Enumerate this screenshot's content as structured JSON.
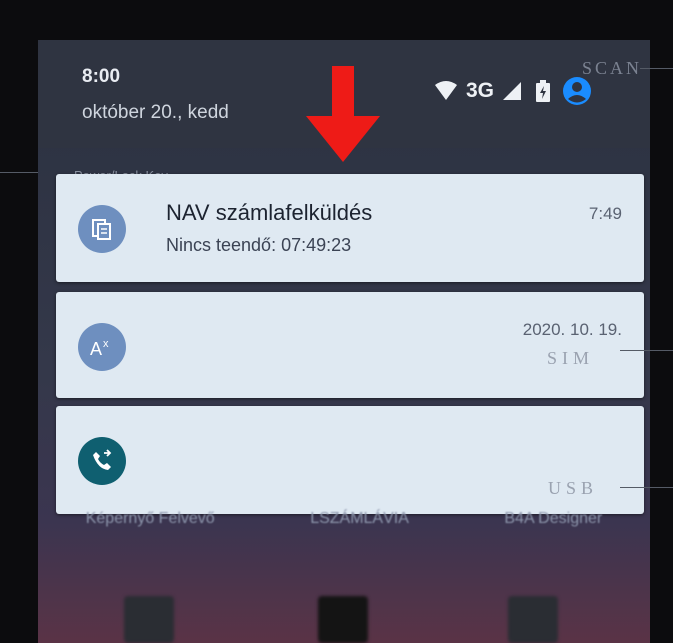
{
  "status_bar": {
    "time": "8:00",
    "date": "október 20., kedd",
    "network_label": "3G",
    "icons": [
      "wifi-icon",
      "signal-icon",
      "battery-icon",
      "account-icon"
    ],
    "account_color": "#1a8cff"
  },
  "device_labels": {
    "scan": "SCAN",
    "power": "Power/Lock Key",
    "sim": "SIM",
    "usb": "USB"
  },
  "annotation": {
    "arrow_color": "#ee1b17"
  },
  "notifications": [
    {
      "app_icon": "document-icon",
      "icon_color": "#6e8fbf",
      "title": "NAV számlafelküldés",
      "time": "7:49",
      "text": "Nincs teendő: 07:49:23"
    },
    {
      "app_icon": "translate-icon",
      "icon_color": "#6e8fbf",
      "title": "",
      "time": "2020. 10. 19.",
      "text": ""
    },
    {
      "app_icon": "phone-forward-icon",
      "icon_color": "#0f5f70",
      "title": "",
      "time": "",
      "text": ""
    }
  ],
  "home_apps": [
    "Képernyő Felvevő",
    "LSZÁMLÁVIA",
    "B4A Designer"
  ]
}
